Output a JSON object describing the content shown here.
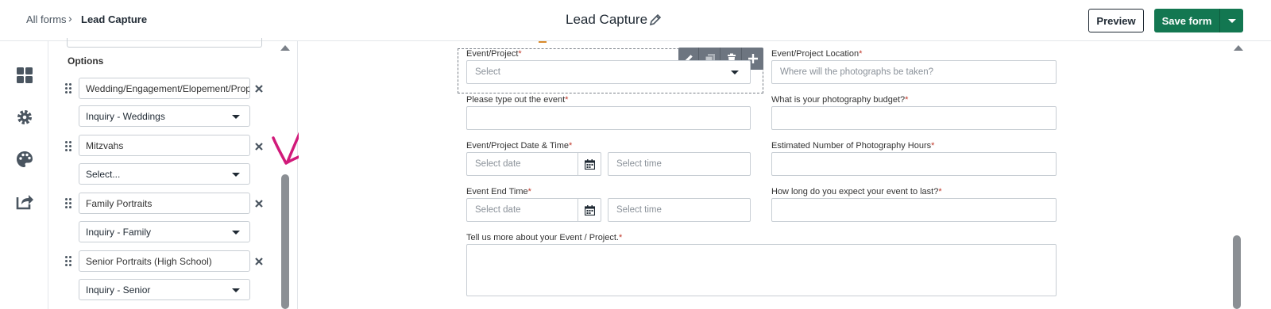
{
  "header": {
    "breadcrumb_root": "All forms",
    "breadcrumb_separator": "›",
    "breadcrumb_current": "Lead Capture",
    "title": "Lead Capture",
    "preview_label": "Preview",
    "save_label": "Save form",
    "accent_color": "#137751"
  },
  "rail": {
    "icons": [
      "dashboard-icon",
      "gear-icon",
      "palette-icon",
      "share-icon"
    ]
  },
  "options_panel": {
    "heading": "Options",
    "options": [
      {
        "label": "Wedding/Engagement/Elopement/Proposal",
        "mapping": "Inquiry - Weddings"
      },
      {
        "label": "Mitzvahs",
        "mapping": "Select..."
      },
      {
        "label": "Family Portraits",
        "mapping": "Inquiry - Family"
      },
      {
        "label": "Senior Portraits (High School)",
        "mapping": "Inquiry - Senior"
      }
    ]
  },
  "form": {
    "fields": {
      "event_project": {
        "label": "Event/Project",
        "placeholder": "Select"
      },
      "event_location": {
        "label": "Event/Project Location",
        "placeholder": "Where will the photographs be taken?"
      },
      "type_event": {
        "label": "Please type out the event",
        "placeholder": ""
      },
      "budget": {
        "label": "What is your photography budget?",
        "placeholder": ""
      },
      "event_date": {
        "label": "Event/Project Date & Time",
        "date_placeholder": "Select date",
        "time_placeholder": "Select time"
      },
      "hours": {
        "label": "Estimated Number of Photography Hours",
        "placeholder": ""
      },
      "end_time": {
        "label": "Event End Time",
        "date_placeholder": "Select date",
        "time_placeholder": "Select time"
      },
      "duration": {
        "label": "How long do you expect your event to last?",
        "placeholder": ""
      },
      "more_about": {
        "label": "Tell us more about your Event / Project.",
        "placeholder": ""
      }
    },
    "required_marker": "*",
    "toolbar_icons": [
      "pencil-icon",
      "duplicate-icon",
      "trash-icon",
      "plus-icon"
    ]
  },
  "annotation": {
    "color": "#d11a7a"
  }
}
